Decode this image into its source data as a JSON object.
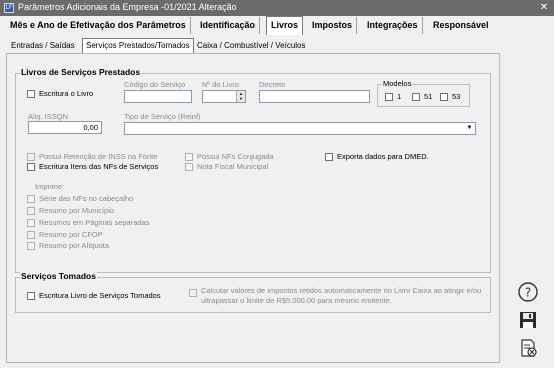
{
  "window": {
    "title": "Parâmetros Adicionais da Empresa -01/2021 Alteração",
    "app_icon_text": "LF",
    "close_glyph": "✕"
  },
  "tabs": [
    {
      "label": "Mês e Ano de Efetivação dos Parâmetros"
    },
    {
      "label": "Identificação"
    },
    {
      "label": "Livros"
    },
    {
      "label": "Impostos"
    },
    {
      "label": "Integrações"
    },
    {
      "label": "Responsável"
    }
  ],
  "subtabs": [
    {
      "label": "Entradas / Saídas"
    },
    {
      "label": "Serviços Prestados/Tomados"
    },
    {
      "label": "Caixa / Combustível / Veículos"
    }
  ],
  "prestados": {
    "title": "Livros de Serviços Prestados",
    "escritura_livro": "Escritura o Livro",
    "codigo_servico_label": "Código do Serviço",
    "codigo_servico_value": "",
    "num_livro_label": "Nº do Livro",
    "num_livro_value": "",
    "decreto_label": "Decreto",
    "decreto_value": "",
    "modelos_label": "Modelos",
    "modelos": [
      "1",
      "51",
      "53"
    ],
    "aliq_label": "Aliq. ISSQN",
    "aliq_value": "0,00",
    "tipo_servico_label": "Tipo de Serviço (Reinf)",
    "tipo_servico_value": "",
    "possui_retencao": "Possui Retenção de INSS na Fonte",
    "escritura_itens": "Escritura Itens das NFs de Serviços",
    "possui_nfs_conjugada": "Possui NFs Conjugada",
    "nota_fiscal_municipal": "Nota Fiscal Municipal",
    "exporta_dados": "Exporta dados para DMED.",
    "imprime_label": "Imprime:",
    "imprime_items": [
      "Série das NFs no cabeçalho",
      "Resumo por Município",
      "Resumos em Páginas separadas",
      "Resumo por CFOP",
      "Resumo por Alíquota"
    ]
  },
  "tomados": {
    "title": "Serviços Tomados",
    "escritura_livro": "Escritura Livro de Serviços Tomados",
    "calcular_line1": "Calcular valores de impostos retidos automaticamente no Livro Caixa ao atingir e/ou",
    "calcular_line2": "ultrapassar o limite de R$5.000,00 para mesmo emitente."
  },
  "sidebar": {
    "icons": [
      "help-icon",
      "save-icon",
      "exit-icon"
    ]
  }
}
